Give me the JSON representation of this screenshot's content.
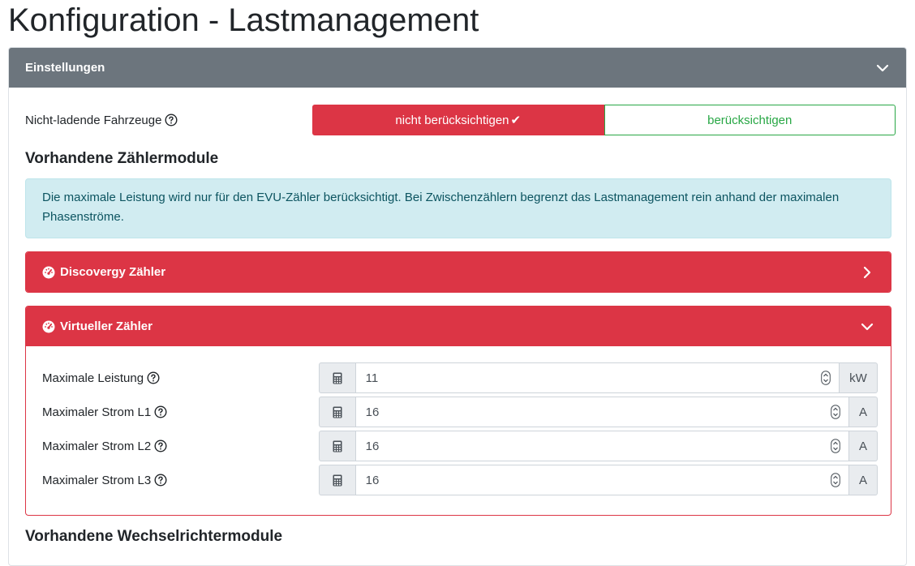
{
  "page": {
    "title": "Konfiguration - Lastmanagement"
  },
  "settings_card": {
    "title": "Einstellungen",
    "non_charging": {
      "label": "Nicht-ladende Fahrzeuge",
      "option_active": "nicht berücksichtigen",
      "option_inactive": "berücksichtigen"
    },
    "meters_heading": "Vorhandene Zählermodule",
    "info_text": "Die maximale Leistung wird nur für den EVU-Zähler berücksichtigt. Bei Zwischenzählern begrenzt das Lastmanagement rein anhand der maximalen Phasenströme.",
    "discovergy": {
      "title": "Discovergy Zähler"
    },
    "virtual": {
      "title": "Virtueller Zähler",
      "fields": [
        {
          "label": "Maximale Leistung",
          "value": "11",
          "unit": "kW"
        },
        {
          "label": "Maximaler Strom L1",
          "value": "16",
          "unit": "A"
        },
        {
          "label": "Maximaler Strom L2",
          "value": "16",
          "unit": "A"
        },
        {
          "label": "Maximaler Strom L3",
          "value": "16",
          "unit": "A"
        }
      ]
    },
    "next_heading": "Vorhandene Wechselrichtermodule"
  },
  "colors": {
    "header_gray": "#6c757d",
    "danger": "#dc3545",
    "success": "#28a745",
    "info_bg": "#d1ecf1",
    "info_text": "#0c5460"
  }
}
